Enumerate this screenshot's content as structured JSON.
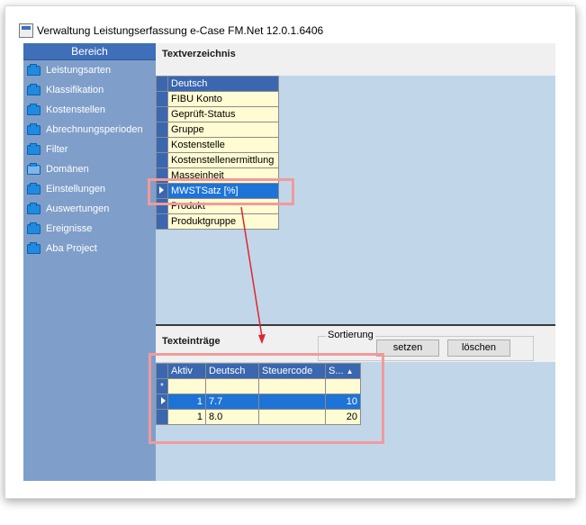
{
  "window": {
    "title": "Verwaltung Leistungserfassung e-Case FM.Net 12.0.1.6406"
  },
  "sidebar": {
    "header": "Bereich",
    "items": [
      {
        "label": "Leistungsarten",
        "icon": "folder-icon"
      },
      {
        "label": "Klassifikation",
        "icon": "folder-icon"
      },
      {
        "label": "Kostenstellen",
        "icon": "folder-icon"
      },
      {
        "label": "Abrechnungsperioden",
        "icon": "folder-icon"
      },
      {
        "label": "Filter",
        "icon": "folder-icon"
      },
      {
        "label": "Domänen",
        "icon": "folder-open-icon"
      },
      {
        "label": "Einstellungen",
        "icon": "folder-icon"
      },
      {
        "label": "Auswertungen",
        "icon": "folder-icon"
      },
      {
        "label": "Ereignisse",
        "icon": "folder-icon"
      },
      {
        "label": "Aba Project",
        "icon": "folder-icon"
      }
    ]
  },
  "textverzeichnis": {
    "title": "Textverzeichnis",
    "column_header": "Deutsch",
    "rows": [
      "FIBU Konto",
      "Geprüft-Status",
      "Gruppe",
      "Kostenstelle",
      "Kostenstellenermittlung",
      "Masseinheit",
      "MWSTSatz [%]",
      "Produkt",
      "Produktgruppe"
    ],
    "selected_index": 6
  },
  "texteintraege": {
    "title": "Texteinträge",
    "sortierung": {
      "legend": "Sortierung",
      "set_button": "setzen",
      "clear_button": "löschen"
    },
    "columns": [
      "Aktiv",
      "Deutsch",
      "Steuercode",
      "S..."
    ],
    "new_row_marker": "*",
    "rows": [
      {
        "aktiv": "1",
        "deutsch": "7.7",
        "steuercode": "",
        "s": "10"
      },
      {
        "aktiv": "1",
        "deutsch": "8.0",
        "steuercode": "",
        "s": "20"
      }
    ],
    "selected_index": 0
  },
  "colors": {
    "sidebar_bg": "#7f9fca",
    "sidebar_header": "#3f6fb8",
    "main_bg": "#c2d6ea",
    "grid_cell": "#fffbd2",
    "grid_header": "#3a67b0",
    "selection": "#1e73d6",
    "annotation": "#f29a9a",
    "arrow": "#e0262c"
  }
}
